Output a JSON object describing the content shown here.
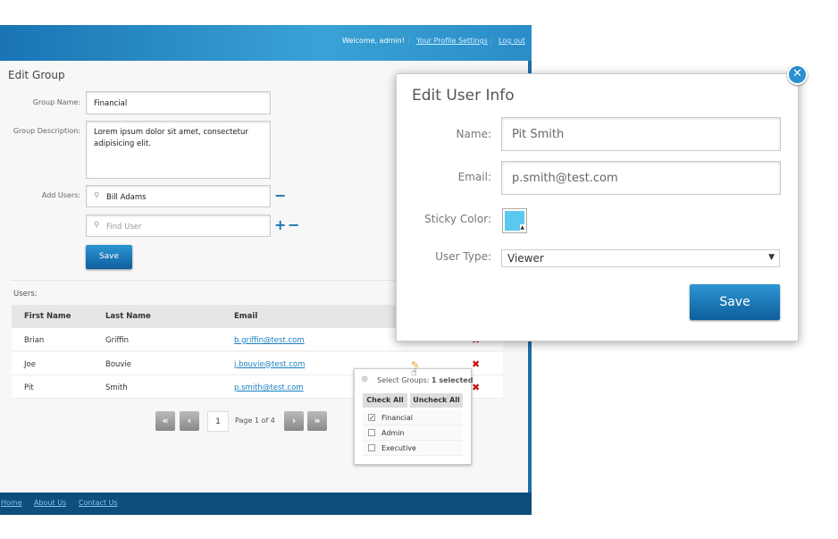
{
  "header": {
    "welcome": "Welcome, admin!",
    "profile_link": "Your Profile Settings",
    "logout_link": "Log out"
  },
  "edit_group": {
    "title": "Edit Group",
    "group_name_label": "Group Name:",
    "group_name_value": "Financial",
    "description_label": "Group Description:",
    "description_value": "Lorem ipsum dolor sit amet, consectetur adipisicing elit.",
    "add_users_label": "Add Users:",
    "added_user": "Bill Adams",
    "find_user_placeholder": "Find User",
    "save_label": "Save"
  },
  "users": {
    "label": "Users:",
    "columns": [
      "First Name",
      "Last Name",
      "Email"
    ],
    "rows": [
      {
        "first": "Brian",
        "last": "Griffin",
        "email": "b.griffin@test.com"
      },
      {
        "first": "Joe",
        "last": "Bouvie",
        "email": "j.bouvie@test.com"
      },
      {
        "first": "Pit",
        "last": "Smith",
        "email": "p.smith@test.com"
      }
    ]
  },
  "pagination": {
    "first": "«",
    "prev": "‹",
    "current": "1",
    "info": "Page 1 of 4",
    "next": "›",
    "last": "»"
  },
  "groups_popup": {
    "title": "Select Groups:",
    "selected": "1 selected",
    "check_all": "Check All",
    "uncheck_all": "Uncheck All",
    "items": [
      {
        "label": "Financial",
        "checked": true
      },
      {
        "label": "Admin",
        "checked": false
      },
      {
        "label": "Executive",
        "checked": false
      }
    ]
  },
  "dialog": {
    "title": "Edit User Info",
    "name_label": "Name:",
    "name_value": "Pit Smith",
    "email_label": "Email:",
    "email_value": "p.smith@test.com",
    "sticky_label": "Sticky Color:",
    "sticky_color": "#5bc8f0",
    "user_type_label": "User Type:",
    "user_type_value": "Viewer",
    "save_label": "Save"
  },
  "footer": {
    "links": [
      "Home",
      "About Us",
      "Contact Us"
    ]
  }
}
